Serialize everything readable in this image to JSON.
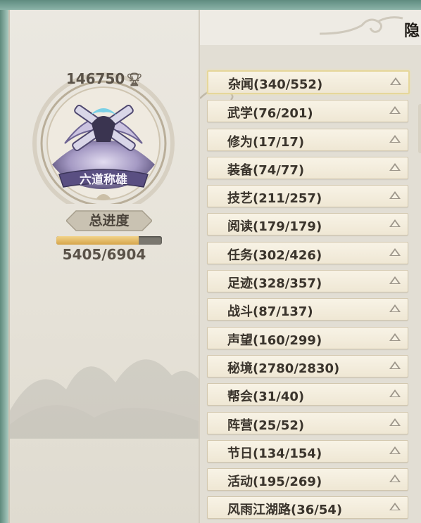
{
  "achievement_points": "146750",
  "emblem": {
    "title": "六道称雄",
    "icon": "crossed-swords-emblem-icon"
  },
  "progress": {
    "label": "总进度",
    "count_text": "5405/6904",
    "fraction": 0.783
  },
  "header_title": "隐",
  "categories": [
    {
      "label": "杂闻(340/552)",
      "selected": true
    },
    {
      "label": "武学(76/201)"
    },
    {
      "label": "修为(17/17)"
    },
    {
      "label": "装备(74/77)"
    },
    {
      "label": "技艺(211/257)"
    },
    {
      "label": "阅读(179/179)"
    },
    {
      "label": "任务(302/426)"
    },
    {
      "label": "足迹(328/357)"
    },
    {
      "label": "战斗(87/137)"
    },
    {
      "label": "声望(160/299)"
    },
    {
      "label": "秘境(2780/2830)"
    },
    {
      "label": "帮会(31/40)"
    },
    {
      "label": "阵营(25/52)"
    },
    {
      "label": "节日(134/154)"
    },
    {
      "label": "活动(195/269)"
    },
    {
      "label": "风雨江湖路(36/54)"
    }
  ],
  "colors": {
    "progress_fill": "#d6a54a",
    "selected_border": "#e6d79a",
    "frame": "#7fa79d"
  }
}
